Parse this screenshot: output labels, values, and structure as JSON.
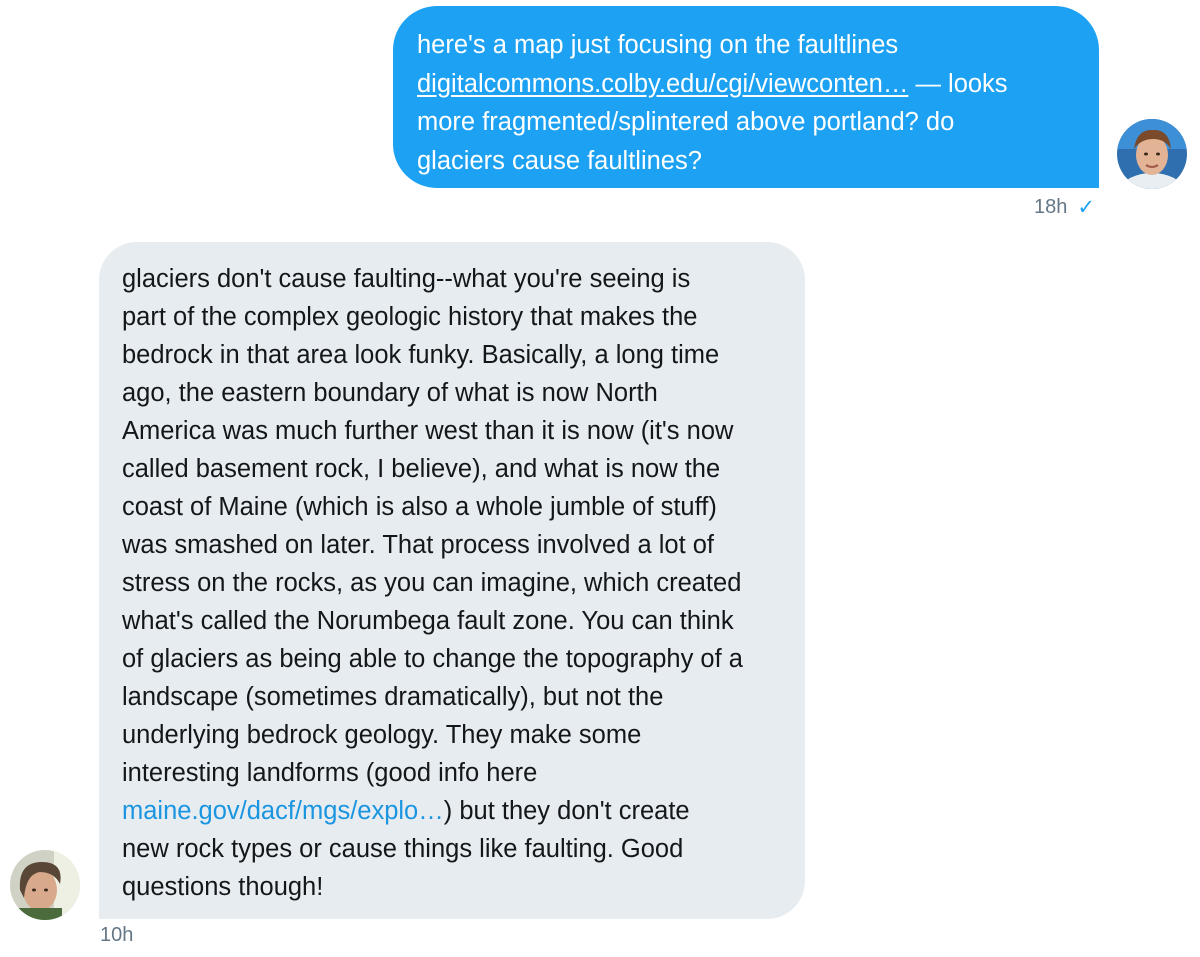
{
  "conversation": {
    "outgoing": {
      "line1": "here's a map just focusing on the faultlines",
      "link_text": "digitalcommons.colby.edu/cgi/viewconten…",
      "line2_after_link": " — looks",
      "line3": "more fragmented/splintered above portland? do",
      "line4": "glaciers cause faultlines?",
      "timestamp": "18h",
      "read_status": "✓",
      "avatar_icon": "user-avatar-icon"
    },
    "incoming": {
      "lines": [
        "glaciers don't cause faulting--what you're seeing is",
        "part of the complex geologic history that makes the",
        "bedrock in that area look funky. Basically, a long time",
        "ago, the eastern boundary of what is now North",
        "America was much further west than it is now (it's now",
        "called basement rock, I believe), and what is now the",
        "coast of Maine (which is also a whole jumble of stuff)",
        "was smashed on later. That process involved a lot of",
        "stress on the rocks, as you can imagine, which created",
        "what's called the Norumbega fault zone. You can think",
        "of glaciers as being able to change the topography of a",
        "landscape (sometimes dramatically), but not the",
        "underlying bedrock geology. They make some",
        "interesting landforms (good info here"
      ],
      "link_text": "maine.gov/dacf/mgs/explo…",
      "after_link": ") but they don't create",
      "line_16": "new rock types or cause things like faulting. Good",
      "line_17": "questions though!",
      "timestamp": "10h",
      "avatar_icon": "contact-avatar-icon"
    }
  },
  "colors": {
    "outgoing_bubble": "#1da1f2",
    "incoming_bubble": "#e6ecf0",
    "link_blue": "#1b95e0",
    "meta_gray": "#657786"
  }
}
